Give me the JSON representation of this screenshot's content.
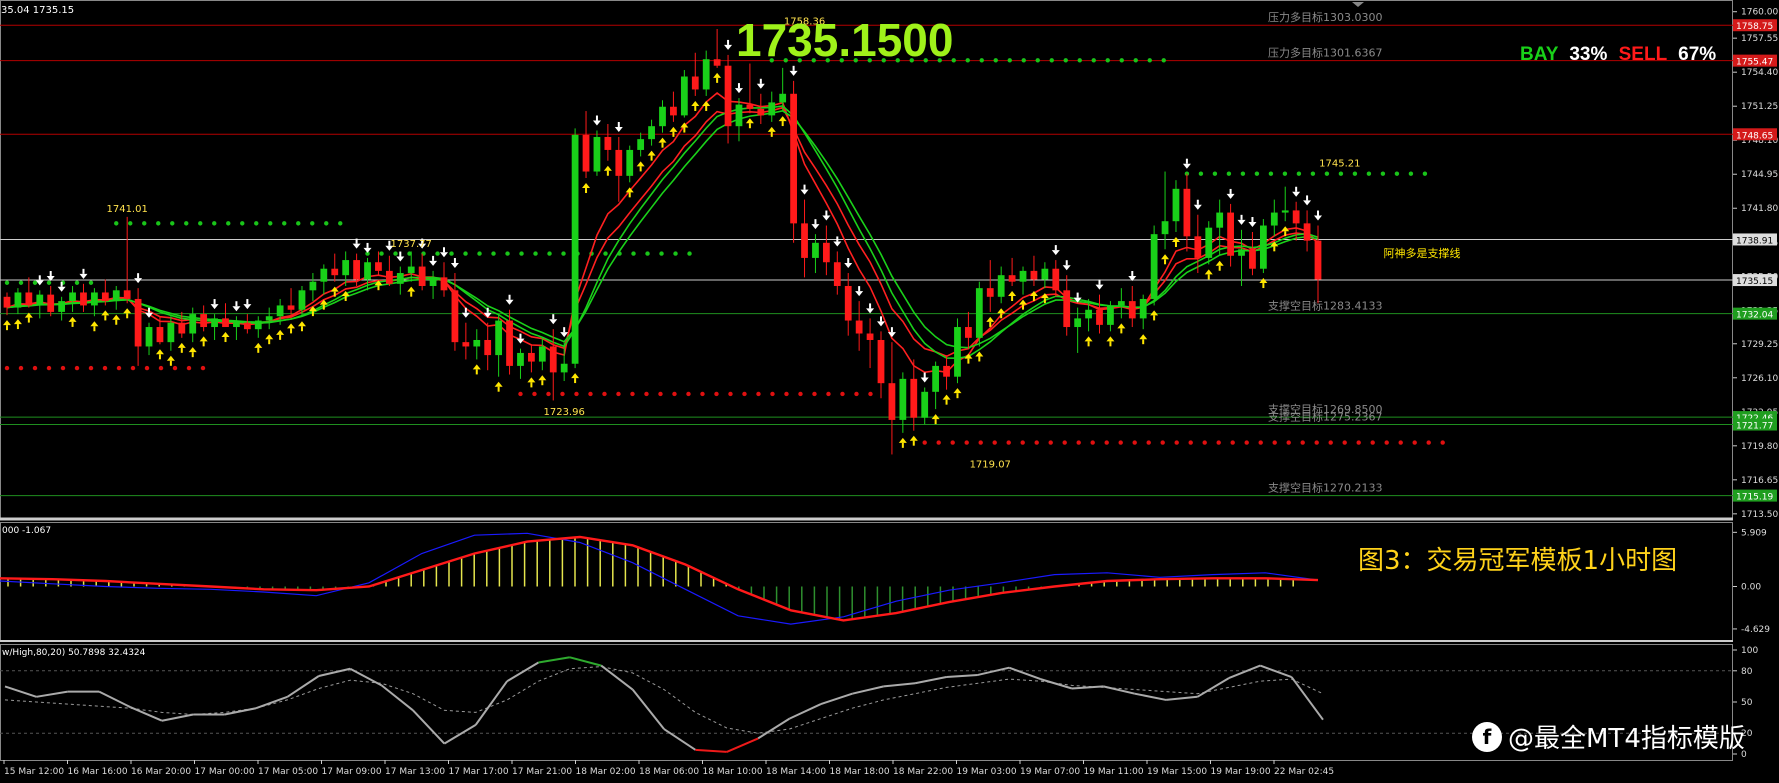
{
  "header": {
    "symbol_info": "35.04 1735.15",
    "big_price": "1735.1500",
    "bay_label": "BAY",
    "bay_pct": "33%",
    "sell_label": "SELL",
    "sell_pct": "67%"
  },
  "caption": "图3：交易冠军模板1小时图",
  "watermark": "@最全MT4指标模版",
  "colors": {
    "bull": "#19d119",
    "bear": "#ff1a1a",
    "up_arrow": "#ffe600",
    "down_arrow": "#ffffff",
    "big_price": "#9ff21a",
    "level_red": "#b30000",
    "level_green": "#1f8f1f",
    "ma_green": "#1ad11a",
    "ma_red": "#ff2020",
    "macd_signal": "#ff1a1a",
    "macd_main": "#1a1aff",
    "caption": "#ffd21a"
  },
  "chart_data": {
    "type": "candlestick",
    "main_panel": {
      "y_ticks": [
        "1760.00",
        "1757.55",
        "1754.40",
        "1751.25",
        "1748.10",
        "1744.95",
        "1741.80",
        "1738.65",
        "1735.50",
        "1732.35",
        "1729.25",
        "1726.10",
        "1722.95",
        "1719.80",
        "1716.65",
        "1713.50"
      ],
      "ylim": [
        1713.3,
        1760.9
      ],
      "right_tags": [
        {
          "value": "1758.75",
          "price": 1758.75,
          "color": "#d41a1a"
        },
        {
          "value": "1755.47",
          "price": 1755.47,
          "color": "#d41a1a"
        },
        {
          "value": "1748.65",
          "price": 1748.65,
          "color": "#d41a1a"
        },
        {
          "value": "1738.91",
          "price": 1738.91,
          "color": "#dddddd",
          "text_color": "#000000"
        },
        {
          "value": "1735.15",
          "price": 1735.15,
          "color": "#dddddd",
          "text_color": "#000000"
        },
        {
          "value": "1732.04",
          "price": 1732.04,
          "color": "#1f9e1f"
        },
        {
          "value": "1722.46",
          "price": 1722.46,
          "color": "#1f9e1f"
        },
        {
          "value": "1721.77",
          "price": 1721.77,
          "color": "#1f9e1f"
        },
        {
          "value": "1715.19",
          "price": 1715.19,
          "color": "#1f9e1f"
        }
      ],
      "level_labels": [
        {
          "text": "压力多目标1303.0300",
          "price": 1758.75
        },
        {
          "text": "压力多目标1301.6367",
          "price": 1755.47
        },
        {
          "text": "支撑空目标1283.4133",
          "price": 1732.04
        },
        {
          "text": "支撑空目标1269.8500",
          "price": 1722.46
        },
        {
          "text": "支撑空目标1275.2367",
          "price": 1721.77
        },
        {
          "text": "支撑空目标1270.2133",
          "price": 1715.19
        }
      ],
      "overlay_text": "阿神多是支撑线",
      "annotations": [
        {
          "text": "1741.01",
          "bar": 11,
          "price": 1741.01
        },
        {
          "text": "1737.77",
          "bar": 37,
          "price": 1737.77
        },
        {
          "text": "1723.96",
          "bar": 51,
          "price": 1723.96
        },
        {
          "text": "1758.36",
          "bar": 73,
          "price": 1758.36
        },
        {
          "text": "1719.07",
          "bar": 90,
          "price": 1719.07
        },
        {
          "text": "1745.21",
          "bar": 122,
          "price": 1745.21
        }
      ],
      "candles": [
        [
          1733.6,
          1734.0,
          1731.9,
          1732.6
        ],
        [
          1732.6,
          1734.4,
          1732.0,
          1734.0
        ],
        [
          1734.0,
          1735.4,
          1732.6,
          1732.8
        ],
        [
          1732.8,
          1734.2,
          1731.6,
          1733.8
        ],
        [
          1733.8,
          1734.6,
          1731.8,
          1732.2
        ],
        [
          1732.2,
          1733.6,
          1731.4,
          1733.2
        ],
        [
          1733.2,
          1734.6,
          1732.2,
          1734.0
        ],
        [
          1734.0,
          1734.8,
          1732.2,
          1732.8
        ],
        [
          1732.8,
          1734.4,
          1731.8,
          1734.0
        ],
        [
          1734.0,
          1735.2,
          1732.8,
          1733.2
        ],
        [
          1733.2,
          1734.6,
          1732.4,
          1734.2
        ],
        [
          1734.2,
          1741.0,
          1733.0,
          1733.4
        ],
        [
          1733.4,
          1734.4,
          1727.2,
          1729.0
        ],
        [
          1729.0,
          1731.2,
          1728.2,
          1730.8
        ],
        [
          1730.8,
          1731.8,
          1729.2,
          1729.4
        ],
        [
          1729.4,
          1731.8,
          1728.6,
          1731.2
        ],
        [
          1731.2,
          1732.2,
          1729.8,
          1730.2
        ],
        [
          1730.2,
          1732.6,
          1729.4,
          1732.0
        ],
        [
          1732.0,
          1732.8,
          1730.4,
          1730.8
        ],
        [
          1730.8,
          1732.0,
          1729.6,
          1731.6
        ],
        [
          1731.6,
          1733.0,
          1730.8,
          1730.8
        ],
        [
          1730.8,
          1731.8,
          1729.6,
          1731.2
        ],
        [
          1731.2,
          1732.0,
          1730.2,
          1730.6
        ],
        [
          1730.6,
          1731.8,
          1729.8,
          1731.4
        ],
        [
          1731.4,
          1732.6,
          1730.6,
          1731.8
        ],
        [
          1731.8,
          1733.4,
          1731.0,
          1732.8
        ],
        [
          1732.8,
          1734.4,
          1731.6,
          1732.4
        ],
        [
          1732.4,
          1734.6,
          1731.8,
          1734.2
        ],
        [
          1734.2,
          1735.8,
          1733.2,
          1735.0
        ],
        [
          1735.0,
          1736.6,
          1733.8,
          1736.2
        ],
        [
          1736.2,
          1737.6,
          1735.0,
          1735.6
        ],
        [
          1735.6,
          1737.8,
          1734.6,
          1737.0
        ],
        [
          1737.0,
          1737.6,
          1734.6,
          1735.2
        ],
        [
          1735.2,
          1737.2,
          1734.2,
          1736.8
        ],
        [
          1736.8,
          1737.8,
          1735.6,
          1736.0
        ],
        [
          1736.0,
          1737.4,
          1734.6,
          1734.8
        ],
        [
          1734.8,
          1736.4,
          1733.8,
          1735.8
        ],
        [
          1735.8,
          1737.8,
          1735.0,
          1736.4
        ],
        [
          1736.4,
          1737.6,
          1734.2,
          1734.6
        ],
        [
          1734.6,
          1736.0,
          1733.4,
          1735.4
        ],
        [
          1735.4,
          1736.8,
          1733.6,
          1734.2
        ],
        [
          1734.2,
          1735.8,
          1728.6,
          1729.4
        ],
        [
          1729.4,
          1731.2,
          1727.8,
          1729.0
        ],
        [
          1729.0,
          1730.6,
          1727.8,
          1729.6
        ],
        [
          1729.6,
          1731.2,
          1726.8,
          1728.2
        ],
        [
          1728.2,
          1732.0,
          1726.2,
          1731.4
        ],
        [
          1731.4,
          1732.4,
          1726.4,
          1727.2
        ],
        [
          1727.2,
          1728.8,
          1726.0,
          1728.4
        ],
        [
          1728.4,
          1729.2,
          1726.6,
          1727.6
        ],
        [
          1727.6,
          1729.8,
          1726.8,
          1729.0
        ],
        [
          1729.0,
          1730.6,
          1724.0,
          1726.6
        ],
        [
          1726.6,
          1729.4,
          1725.8,
          1727.4
        ],
        [
          1727.4,
          1749.2,
          1727.0,
          1748.6
        ],
        [
          1748.6,
          1750.8,
          1744.6,
          1745.2
        ],
        [
          1745.2,
          1749.0,
          1744.8,
          1748.4
        ],
        [
          1748.4,
          1749.6,
          1746.2,
          1747.2
        ],
        [
          1747.2,
          1748.4,
          1742.4,
          1744.8
        ],
        [
          1744.8,
          1747.6,
          1744.2,
          1747.2
        ],
        [
          1747.2,
          1748.8,
          1746.6,
          1748.2
        ],
        [
          1748.2,
          1750.0,
          1747.6,
          1749.4
        ],
        [
          1749.4,
          1751.8,
          1748.8,
          1751.2
        ],
        [
          1751.2,
          1752.6,
          1749.8,
          1750.4
        ],
        [
          1750.4,
          1754.6,
          1750.2,
          1754.0
        ],
        [
          1754.0,
          1756.2,
          1752.2,
          1752.8
        ],
        [
          1752.8,
          1756.4,
          1752.2,
          1755.6
        ],
        [
          1755.6,
          1758.4,
          1754.8,
          1755.0
        ],
        [
          1755.0,
          1756.0,
          1747.8,
          1749.4
        ],
        [
          1749.4,
          1752.0,
          1748.0,
          1751.4
        ],
        [
          1751.4,
          1755.2,
          1750.6,
          1751.0
        ],
        [
          1751.0,
          1752.4,
          1749.6,
          1750.4
        ],
        [
          1750.4,
          1752.6,
          1749.8,
          1751.6
        ],
        [
          1751.6,
          1754.8,
          1750.8,
          1752.4
        ],
        [
          1752.4,
          1753.6,
          1738.6,
          1740.4
        ],
        [
          1740.4,
          1742.6,
          1735.4,
          1737.2
        ],
        [
          1737.2,
          1739.4,
          1735.8,
          1738.6
        ],
        [
          1738.6,
          1740.2,
          1735.6,
          1736.8
        ],
        [
          1736.8,
          1737.8,
          1733.8,
          1734.6
        ],
        [
          1734.6,
          1735.8,
          1730.0,
          1731.4
        ],
        [
          1731.4,
          1733.2,
          1728.6,
          1730.2
        ],
        [
          1730.2,
          1731.6,
          1727.0,
          1729.6
        ],
        [
          1729.6,
          1730.4,
          1724.2,
          1725.6
        ],
        [
          1725.6,
          1729.4,
          1719.0,
          1722.2
        ],
        [
          1722.2,
          1726.6,
          1721.0,
          1726.0
        ],
        [
          1726.0,
          1727.8,
          1721.2,
          1722.4
        ],
        [
          1722.4,
          1725.2,
          1721.8,
          1724.8
        ],
        [
          1724.8,
          1727.6,
          1723.2,
          1727.2
        ],
        [
          1727.2,
          1728.2,
          1725.0,
          1726.2
        ],
        [
          1726.2,
          1731.6,
          1725.6,
          1730.8
        ],
        [
          1730.8,
          1732.2,
          1728.8,
          1729.8
        ],
        [
          1729.8,
          1735.0,
          1729.0,
          1734.4
        ],
        [
          1734.4,
          1737.0,
          1732.2,
          1733.6
        ],
        [
          1733.6,
          1736.4,
          1733.0,
          1735.6
        ],
        [
          1735.6,
          1737.2,
          1734.6,
          1735.0
        ],
        [
          1735.0,
          1736.4,
          1733.8,
          1736.0
        ],
        [
          1736.0,
          1737.4,
          1734.6,
          1735.2
        ],
        [
          1735.2,
          1736.8,
          1734.4,
          1736.2
        ],
        [
          1736.2,
          1737.0,
          1733.6,
          1734.2
        ],
        [
          1734.2,
          1735.6,
          1730.0,
          1730.8
        ],
        [
          1730.8,
          1732.6,
          1728.4,
          1731.6
        ],
        [
          1731.6,
          1733.4,
          1730.4,
          1732.4
        ],
        [
          1732.4,
          1733.8,
          1730.2,
          1731.0
        ],
        [
          1731.0,
          1733.2,
          1730.4,
          1732.8
        ],
        [
          1732.8,
          1734.4,
          1731.6,
          1733.2
        ],
        [
          1733.2,
          1734.6,
          1730.8,
          1731.6
        ],
        [
          1731.6,
          1733.8,
          1730.6,
          1733.4
        ],
        [
          1733.4,
          1740.2,
          1732.8,
          1739.4
        ],
        [
          1739.4,
          1745.2,
          1738.0,
          1740.6
        ],
        [
          1740.6,
          1744.4,
          1739.6,
          1743.6
        ],
        [
          1743.6,
          1745.0,
          1737.8,
          1739.2
        ],
        [
          1739.2,
          1741.2,
          1735.8,
          1737.2
        ],
        [
          1737.2,
          1740.6,
          1736.6,
          1740.0
        ],
        [
          1740.0,
          1742.6,
          1737.4,
          1741.4
        ],
        [
          1741.4,
          1742.2,
          1736.4,
          1737.4
        ],
        [
          1737.4,
          1739.8,
          1734.6,
          1738.0
        ],
        [
          1738.0,
          1739.6,
          1735.6,
          1736.2
        ],
        [
          1736.2,
          1740.8,
          1735.8,
          1740.2
        ],
        [
          1740.2,
          1742.6,
          1739.2,
          1741.4
        ],
        [
          1741.4,
          1743.8,
          1740.6,
          1741.6
        ],
        [
          1741.6,
          1742.4,
          1738.8,
          1740.4
        ],
        [
          1740.4,
          1741.6,
          1737.8,
          1738.8
        ],
        [
          1738.8,
          1740.2,
          1733.0,
          1735.2
        ]
      ]
    },
    "macd_panel": {
      "y_ticks": [
        "5.909",
        "0.00",
        "-4.629"
      ],
      "label": "000 -1.067",
      "ylim": [
        -5.4,
        6.6
      ],
      "series": [
        {
          "name": "signal",
          "values": [
            0.9,
            0.8,
            0.6,
            0.3,
            0.0,
            -0.3,
            -0.4,
            0.0,
            1.8,
            3.6,
            4.9,
            5.4,
            4.5,
            2.4,
            -0.3,
            -2.6,
            -3.7,
            -2.9,
            -1.7,
            -0.7,
            0.0,
            0.6,
            0.8,
            0.9,
            0.9,
            0.7
          ]
        },
        {
          "name": "main",
          "values": [
            0.6,
            0.3,
            0.0,
            -0.2,
            -0.3,
            -0.6,
            -1.0,
            0.4,
            3.6,
            5.6,
            5.8,
            4.8,
            2.6,
            -0.3,
            -3.2,
            -4.1,
            -3.3,
            -1.6,
            -0.4,
            0.4,
            1.3,
            1.5,
            1.0,
            1.3,
            1.5,
            0.7
          ]
        }
      ]
    },
    "wpr_panel": {
      "label": "w/High,80,20) 50.7898 32.4324",
      "y_ticks": [
        "100",
        "80",
        "50",
        "20",
        "0"
      ],
      "ylim": [
        0,
        100
      ],
      "series": [
        {
          "name": "fast",
          "values": [
            65,
            55,
            60,
            60,
            45,
            32,
            38,
            38,
            44,
            55,
            75,
            82,
            66,
            42,
            10,
            28,
            70,
            88,
            93,
            85,
            62,
            24,
            4,
            2,
            15,
            34,
            48,
            58,
            65,
            68,
            74,
            76,
            83,
            72,
            63,
            65,
            58,
            52,
            55,
            73,
            85,
            74,
            33
          ]
        },
        {
          "name": "slow",
          "values": [
            52,
            50,
            48,
            46,
            44,
            40,
            38,
            40,
            44,
            52,
            63,
            71,
            68,
            58,
            42,
            40,
            52,
            70,
            82,
            84,
            78,
            62,
            40,
            25,
            20,
            24,
            34,
            44,
            52,
            58,
            64,
            68,
            72,
            70,
            66,
            64,
            62,
            60,
            58,
            64,
            70,
            72,
            58
          ]
        }
      ]
    },
    "x_ticks": [
      "15 Mar 12:00",
      "16 Mar 16:00",
      "16 Mar 20:00",
      "17 Mar 00:00",
      "17 Mar 05:00",
      "17 Mar 09:00",
      "17 Mar 13:00",
      "17 Mar 17:00",
      "17 Mar 21:00",
      "18 Mar 02:00",
      "18 Mar 06:00",
      "18 Mar 10:00",
      "18 Mar 14:00",
      "18 Mar 18:00",
      "18 Mar 22:00",
      "19 Mar 03:00",
      "19 Mar 07:00",
      "19 Mar 11:00",
      "19 Mar 15:00",
      "19 Mar 19:00",
      "22 Mar 02:45"
    ]
  }
}
